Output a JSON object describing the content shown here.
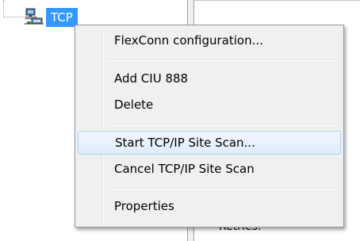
{
  "tree": {
    "node_label": "TCP",
    "node_icon": "network-computer-icon"
  },
  "right_panel": {
    "visible_label": "Retries:"
  },
  "context_menu": {
    "items": [
      {
        "label": "FlexConn configuration..."
      },
      {
        "label": "Add CIU 888"
      },
      {
        "label": "Delete"
      },
      {
        "label": "Start TCP/IP Site Scan..."
      },
      {
        "label": "Cancel TCP/IP Site Scan"
      },
      {
        "label": "Properties"
      }
    ],
    "hovered_item": "Start TCP/IP Site Scan..."
  },
  "colors": {
    "selection": "#3399ff",
    "menu_background": "#f0f0f0",
    "hover_border": "#aecff7"
  }
}
